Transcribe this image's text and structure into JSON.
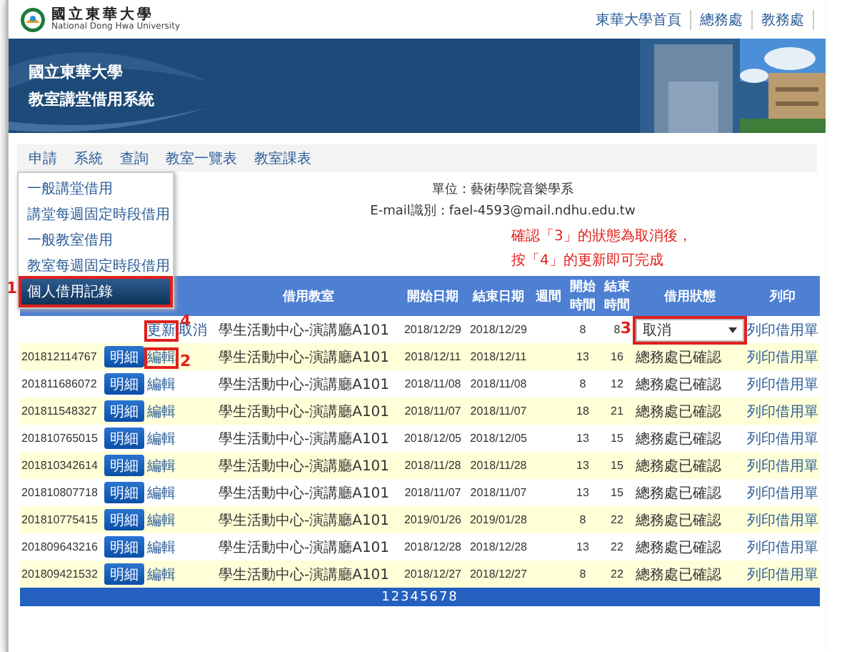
{
  "header": {
    "logo_title": "國立東華大學",
    "logo_subtitle": "National Dong Hwa University",
    "links": [
      "東華大學首頁",
      "總務處",
      "教務處"
    ]
  },
  "banner": {
    "title_lines": [
      "國立東華大學",
      "教室講堂借用系統"
    ]
  },
  "nav": {
    "items": [
      "申請",
      "系統",
      "查詢",
      "教室一覽表",
      "教室課表"
    ]
  },
  "menu": {
    "items": [
      {
        "label": "一般講堂借用",
        "selected": false,
        "highlighted": false
      },
      {
        "label": "講堂每週固定時段借用",
        "selected": false,
        "highlighted": false
      },
      {
        "label": "一般教室借用",
        "selected": false,
        "highlighted": false
      },
      {
        "label": "教室每週固定時段借用",
        "selected": false,
        "highlighted": false
      },
      {
        "label": "個人借用記錄",
        "selected": true,
        "highlighted": true,
        "callout": "1"
      }
    ]
  },
  "user_info": [
    {
      "label": "單位：",
      "value": "藝術學院音樂學系"
    },
    {
      "label": "E-mail識別：",
      "value": "fael-4593@mail.ndhu.edu.tw"
    }
  ],
  "instruction": [
    "確認「3」的狀態為取消後，",
    "按「4」的更新即可完成"
  ],
  "table": {
    "columns": [
      "借用教室",
      "開始日期",
      "結束日期",
      "週間",
      "開始時間",
      "結束時間",
      "借用狀態",
      "列印"
    ],
    "rows": [
      {
        "actions": [
          {
            "label": "更新",
            "highlighted": true,
            "callout": "4"
          },
          {
            "label": "取消",
            "highlighted": false
          }
        ],
        "room": "學生活動中心-演講廳A101",
        "start_date": "2018/12/29",
        "end_date": "2018/12/29",
        "start_time": "8",
        "end_time": "8",
        "status": {
          "kind": "select",
          "value": "取消",
          "highlighted": true,
          "callout": "3"
        },
        "print": "列印借用單"
      },
      {
        "id": "201812114767",
        "detail": "明細",
        "actions": [
          {
            "label": "編輯",
            "highlighted": true,
            "callout": "2"
          }
        ],
        "room": "學生活動中心-演講廳A101",
        "start_date": "2018/12/11",
        "end_date": "2018/12/11",
        "start_time": "13",
        "end_time": "16",
        "status": {
          "kind": "text",
          "value": "總務處已確認",
          "highlighted": false
        },
        "print": "列印借用單"
      },
      {
        "id": "201811686072",
        "detail": "明細",
        "actions": [
          {
            "label": "編輯",
            "highlighted": false
          }
        ],
        "room": "學生活動中心-演講廳A101",
        "start_date": "2018/11/08",
        "end_date": "2018/11/08",
        "start_time": "8",
        "end_time": "12",
        "status": {
          "kind": "text",
          "value": "總務處已確認",
          "highlighted": false
        },
        "print": "列印借用單"
      },
      {
        "id": "201811548327",
        "detail": "明細",
        "actions": [
          {
            "label": "編輯",
            "highlighted": false
          }
        ],
        "room": "學生活動中心-演講廳A101",
        "start_date": "2018/11/07",
        "end_date": "2018/11/07",
        "start_time": "18",
        "end_time": "21",
        "status": {
          "kind": "text",
          "value": "總務處已確認",
          "highlighted": false
        },
        "print": "列印借用單"
      },
      {
        "id": "201810765015",
        "detail": "明細",
        "actions": [
          {
            "label": "編輯",
            "highlighted": false
          }
        ],
        "room": "學生活動中心-演講廳A101",
        "start_date": "2018/12/05",
        "end_date": "2018/12/05",
        "start_time": "13",
        "end_time": "15",
        "status": {
          "kind": "text",
          "value": "總務處已確認",
          "highlighted": false
        },
        "print": "列印借用單"
      },
      {
        "id": "201810342614",
        "detail": "明細",
        "actions": [
          {
            "label": "編輯",
            "highlighted": false
          }
        ],
        "room": "學生活動中心-演講廳A101",
        "start_date": "2018/11/28",
        "end_date": "2018/11/28",
        "start_time": "13",
        "end_time": "15",
        "status": {
          "kind": "text",
          "value": "總務處已確認",
          "highlighted": false
        },
        "print": "列印借用單"
      },
      {
        "id": "201810807718",
        "detail": "明細",
        "actions": [
          {
            "label": "編輯",
            "highlighted": false
          }
        ],
        "room": "學生活動中心-演講廳A101",
        "start_date": "2018/11/07",
        "end_date": "2018/11/07",
        "start_time": "13",
        "end_time": "15",
        "status": {
          "kind": "text",
          "value": "總務處已確認",
          "highlighted": false
        },
        "print": "列印借用單"
      },
      {
        "id": "201810775415",
        "detail": "明細",
        "actions": [
          {
            "label": "編輯",
            "highlighted": false
          }
        ],
        "room": "學生活動中心-演講廳A101",
        "start_date": "2019/01/26",
        "end_date": "2019/01/28",
        "start_time": "8",
        "end_time": "22",
        "status": {
          "kind": "text",
          "value": "總務處已確認",
          "highlighted": false
        },
        "print": "列印借用單"
      },
      {
        "id": "201809643216",
        "detail": "明細",
        "actions": [
          {
            "label": "編輯",
            "highlighted": false
          }
        ],
        "room": "學生活動中心-演講廳A101",
        "start_date": "2018/12/28",
        "end_date": "2018/12/28",
        "start_time": "13",
        "end_time": "22",
        "status": {
          "kind": "text",
          "value": "總務處已確認",
          "highlighted": false
        },
        "print": "列印借用單"
      },
      {
        "id": "201809421532",
        "detail": "明細",
        "actions": [
          {
            "label": "編輯",
            "highlighted": false
          }
        ],
        "room": "學生活動中心-演講廳A101",
        "start_date": "2018/12/27",
        "end_date": "2018/12/27",
        "start_time": "8",
        "end_time": "22",
        "status": {
          "kind": "text",
          "value": "總務處已確認",
          "highlighted": false
        },
        "print": "列印借用單"
      }
    ]
  },
  "pagination": "12345678"
}
